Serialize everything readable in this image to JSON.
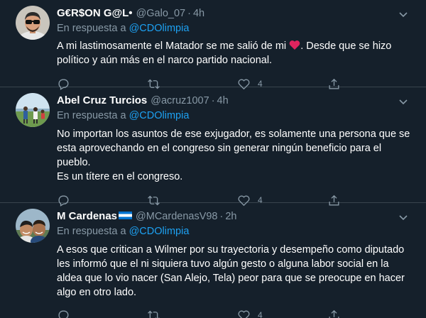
{
  "colors": {
    "background": "#15202b",
    "divider": "#38444d",
    "muted": "#8899a6",
    "link": "#1da1f2",
    "emoji_heart": "#e0245e"
  },
  "tweets": [
    {
      "name": "G€R$ON G@L•",
      "handle": "@Galo_07",
      "time": "4h",
      "reply_prefix": "En respuesta a",
      "reply_mention": "@CDOlimpia",
      "text_before": "A mi lastimosamente el Matador se me salió de mi",
      "text_after": ". Desde que se hizo político y aún más en el narco partido nacional.",
      "like_count": "4",
      "avatar": "man-with-sunglasses"
    },
    {
      "name": "Abel Cruz Turcios",
      "handle": "@acruz1007",
      "time": "4h",
      "reply_prefix": "En respuesta a",
      "reply_mention": "@CDOlimpia",
      "text": "No importan los asuntos de ese exjugador, es solamente una persona que se esta aprovechando en el congreso sin generar ningún beneficio para el pueblo.\nEs un títere en el congreso.",
      "like_count": "4",
      "avatar": "people-on-field"
    },
    {
      "name": "M Cardenas",
      "handle": "@MCardenasV98",
      "time": "2h",
      "reply_prefix": "En respuesta a",
      "reply_mention": "@CDOlimpia",
      "text": "A esos que critican a Wilmer por su trayectoria y desempeño como diputado les informó que el ni siquiera tuvo algún gesto o alguna labor social en la aldea que lo vio nacer (San Alejo, Tela) peor para que se preocupe en hacer algo en otro lado.",
      "like_count": "4",
      "avatar": "two-smiling-people"
    }
  ]
}
